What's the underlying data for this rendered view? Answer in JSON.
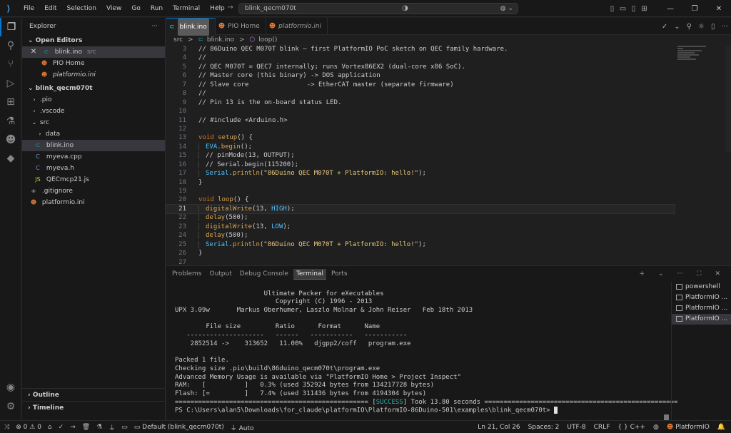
{
  "colors": {
    "accent": "#0078d4",
    "background": "#1f1f1f",
    "sidebar": "#181818",
    "keyword": "#cc7832",
    "function": "#d9a653",
    "string": "#e8c77b",
    "object": "#4fc1ff",
    "success": "#2ab0a8"
  },
  "titlebar": {
    "logo_icon": "vscode-logo-icon",
    "menu": [
      "File",
      "Edit",
      "Selection",
      "View",
      "Go",
      "Run",
      "Terminal",
      "Help"
    ],
    "search_text": "blink_qecm070t"
  },
  "activity": [
    "files-icon",
    "search-icon",
    "source-control-icon",
    "run-debug-icon",
    "extensions-icon",
    "testing-icon",
    "platformio-icon",
    "python-icon"
  ],
  "sidebar": {
    "title": "Explorer",
    "open_editors_title": "Open Editors",
    "open_editors": [
      {
        "name": "blink.ino",
        "desc": "src"
      },
      {
        "name": "PIO Home",
        "desc": ""
      },
      {
        "name": "platformio.ini",
        "desc": ""
      }
    ],
    "project_title": "blink_qecm070t",
    "tree": [
      {
        "name": ".pio",
        "type": "folder"
      },
      {
        "name": ".vscode",
        "type": "folder"
      },
      {
        "name": "src",
        "type": "folder-open"
      },
      {
        "name": "data",
        "type": "folder"
      },
      {
        "name": "blink.ino",
        "type": "file"
      },
      {
        "name": "myeva.cpp",
        "type": "file"
      },
      {
        "name": "myeva.h",
        "type": "file"
      },
      {
        "name": "QECmcp21.js",
        "type": "file"
      },
      {
        "name": ".gitignore",
        "type": "file"
      },
      {
        "name": "platformio.ini",
        "type": "file"
      }
    ],
    "outline_title": "Outline",
    "timeline_title": "Timeline"
  },
  "editor": {
    "tabs": [
      "blink.ino",
      "PIO Home",
      "platformio.ini"
    ],
    "breadcrumb": [
      "src",
      ">",
      "blink.ino",
      ">",
      "loop()"
    ],
    "lines": [
      {
        "n": "3",
        "text": "// 86Duino QEC M070T blink — first PlatformIO PoC sketch on QEC family hardware."
      },
      {
        "n": "4",
        "text": "//"
      },
      {
        "n": "5",
        "text": "// QEC M070T = QEC7 internally; runs Vortex86EX2 (dual-core x86 SoC)."
      },
      {
        "n": "6",
        "text": "// Master core (this binary) -> DOS application"
      },
      {
        "n": "7",
        "text": "// Slave core               -> EtherCAT master (separate firmware)"
      },
      {
        "n": "8",
        "text": "//"
      },
      {
        "n": "9",
        "text": "// Pin 13 is the on-board status LED."
      },
      {
        "n": "10",
        "text": ""
      },
      {
        "n": "11",
        "text": "// #include <Arduino.h>"
      },
      {
        "n": "12",
        "text": ""
      },
      {
        "n": "13",
        "kw": "void",
        "fn": "setup",
        "rest": "() {"
      },
      {
        "n": "14",
        "obj": "EVA",
        "dot": ".",
        "fn": "begin",
        "rest": "();",
        "indent": true
      },
      {
        "n": "15",
        "text": "// pinMode(13, OUTPUT);",
        "indent": true
      },
      {
        "n": "16",
        "text": "// Serial.begin(115200);",
        "indent": true
      },
      {
        "n": "17",
        "obj": "Serial",
        "dot": ".",
        "fn": "println",
        "rest": "(",
        "str": "\"86Duino QEC M070T + PlatformIO: hello!\"",
        "end": ");",
        "indent": true
      },
      {
        "n": "18",
        "text": "}"
      },
      {
        "n": "19",
        "text": ""
      },
      {
        "n": "20",
        "kw": "void",
        "fn": "loop",
        "rest": "() {"
      },
      {
        "n": "21",
        "fn": "digitalWrite",
        "rest": "(13, ",
        "con": "HIGH",
        "end": ");",
        "indent": true,
        "current": true
      },
      {
        "n": "22",
        "fn": "delay",
        "rest": "(500);",
        "indent": true
      },
      {
        "n": "23",
        "fn": "digitalWrite",
        "rest": "(13, ",
        "con": "LOW",
        "end": ");",
        "indent": true
      },
      {
        "n": "24",
        "fn": "delay",
        "rest": "(500);",
        "indent": true
      },
      {
        "n": "25",
        "obj": "Serial",
        "dot": ".",
        "fn": "println",
        "rest": "(",
        "str": "\"86Duino QEC M070T + PlatformIO: hello!\"",
        "end": ");",
        "indent": true
      },
      {
        "n": "26",
        "text": "}"
      },
      {
        "n": "27",
        "text": ""
      }
    ]
  },
  "panel": {
    "tabs": [
      "Problems",
      "Output",
      "Debug Console",
      "Terminal",
      "Ports"
    ],
    "terminal_lines": [
      "",
      "                       Ultimate Packer for eXecutables",
      "                          Copyright (C) 1996 - 2013",
      "UPX 3.09w       Markus Oberhumer, Laszlo Molnar & John Reiser   Feb 18th 2013",
      "",
      "        File size         Ratio      Format      Name",
      "   --------------------   ------   -----------   -----------",
      "    2852514 ->    313652   11.00%   djgpp2/coff   program.exe",
      "",
      "Packed 1 file.",
      "Checking size .pio\\build\\86duino_qecm070t\\program.exe",
      "Advanced Memory Usage is available via \"PlatformIO Home > Project Inspect\"",
      "RAM:   [          ]   0.3% (used 352924 bytes from 134217728 bytes)",
      "Flash: [=         ]   7.4% (used 311436 bytes from 4194304 bytes)"
    ],
    "success_pre": "================================================== [",
    "success_word": "SUCCESS",
    "success_post": "] Took 13.80 seconds ==================================================",
    "prompt": "PS C:\\Users\\alan5\\Downloads\\for_claude\\platformIO\\PlatformIO-86Duino-501\\examples\\blink_qecm070t> ",
    "terminals": [
      "powershell",
      "PlatformIO ...",
      "PlatformIO ...",
      "PlatformIO ..."
    ]
  },
  "status": {
    "errors": "0",
    "warnings": "0",
    "env": "Default (blink_qecm070t)",
    "auto": "Auto",
    "position": "Ln 21, Col 26",
    "spaces": "Spaces: 2",
    "encoding": "UTF-8",
    "eol": "CRLF",
    "language": "C++",
    "platformio": "PlatformIO"
  }
}
